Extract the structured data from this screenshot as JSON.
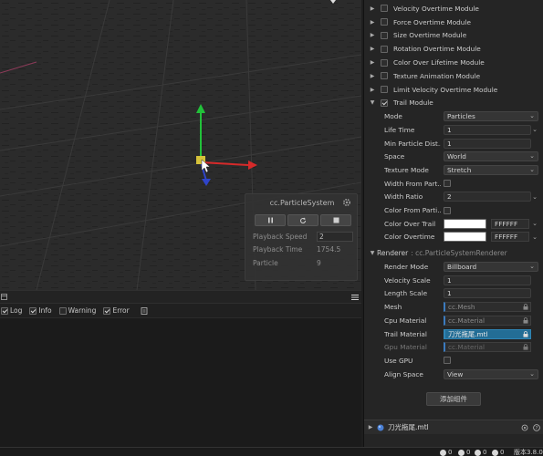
{
  "particle_panel": {
    "title": "cc.ParticleSystem",
    "rows": [
      {
        "label": "Playback Speed",
        "value": "2"
      },
      {
        "label": "Playback Time",
        "value": "1754.5"
      },
      {
        "label": "Particle",
        "value": "9"
      }
    ]
  },
  "console": {
    "filters": [
      {
        "label": "Log",
        "checked": true
      },
      {
        "label": "Info",
        "checked": true
      },
      {
        "label": "Warning",
        "checked": false
      },
      {
        "label": "Error",
        "checked": true
      }
    ]
  },
  "inspector": {
    "modules": [
      {
        "label": "Velocity Overtime Module",
        "checked": false
      },
      {
        "label": "Force Overtime Module",
        "checked": false
      },
      {
        "label": "Size Overtime Module",
        "checked": false
      },
      {
        "label": "Rotation Overtime Module",
        "checked": false
      },
      {
        "label": "Color Over Lifetime Module",
        "checked": false
      },
      {
        "label": "Texture Animation Module",
        "checked": false
      },
      {
        "label": "Limit Velocity Overtime Module",
        "checked": false
      },
      {
        "label": "Trail Module",
        "checked": true
      }
    ],
    "trail": {
      "mode_label": "Mode",
      "mode_value": "Particles",
      "life_time_label": "Life Time",
      "life_time_value": "1",
      "min_dist_label": "Min Particle Dist...",
      "min_dist_value": "1",
      "space_label": "Space",
      "space_value": "World",
      "texture_mode_label": "Texture Mode",
      "texture_mode_value": "Stretch",
      "width_from_label": "Width From Part...",
      "width_ratio_label": "Width Ratio",
      "width_ratio_value": "2",
      "color_from_label": "Color From Parti...",
      "color_over_trail_label": "Color Over Trail",
      "color_over_trail_value": "FFFFFF",
      "color_overtime_label": "Color Overtime",
      "color_overtime_value": "FFFFFF"
    },
    "renderer": {
      "title": "Renderer",
      "component": ": cc.ParticleSystemRenderer",
      "render_mode_label": "Render Mode",
      "render_mode_value": "Billboard",
      "velocity_scale_label": "Velocity Scale",
      "velocity_scale_value": "1",
      "length_scale_label": "Length Scale",
      "length_scale_value": "1",
      "mesh_label": "Mesh",
      "mesh_value": "cc.Mesh",
      "cpu_material_label": "Cpu Material",
      "cpu_material_value": "cc.Material",
      "trail_material_label": "Trail Material",
      "trail_material_value": "刀光拖尾.mtl",
      "gpu_material_label": "Gpu Material",
      "gpu_material_value": "cc.Material",
      "use_gpu_label": "Use GPU",
      "align_space_label": "Align Space",
      "align_space_value": "View"
    },
    "add_component_label": "添加组件",
    "asset_name": "刀光拖尾.mtl"
  },
  "statusbar": {
    "count1": "0",
    "count2": "0",
    "count3": "0",
    "count4": "0",
    "version": "版本3.8.0"
  },
  "colors": {
    "accent": "#3b7bbf",
    "selection": "#236d95",
    "gizmo_y": "#22c13a",
    "gizmo_x": "#d62a2a",
    "gizmo_z": "#2f44c9"
  }
}
